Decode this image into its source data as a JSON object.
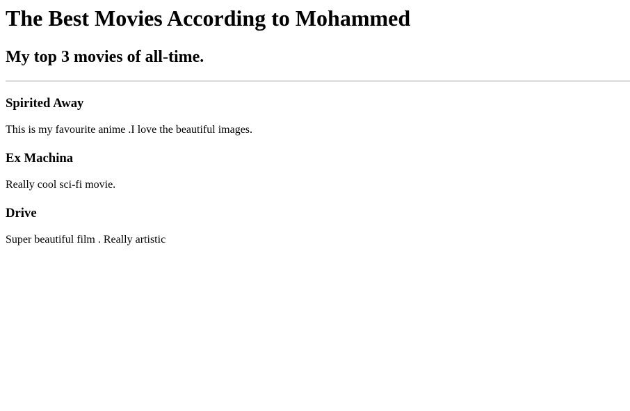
{
  "header": {
    "title": "The Best Movies According to Mohammed",
    "subtitle": "My top 3 movies of all-time."
  },
  "movies": [
    {
      "title": "Spirited Away",
      "description": "This is my favourite anime .I love the beautiful images."
    },
    {
      "title": "Ex Machina",
      "description": "Really cool sci-fi movie."
    },
    {
      "title": "Drive",
      "description": "Super beautiful film . Really artistic"
    }
  ]
}
